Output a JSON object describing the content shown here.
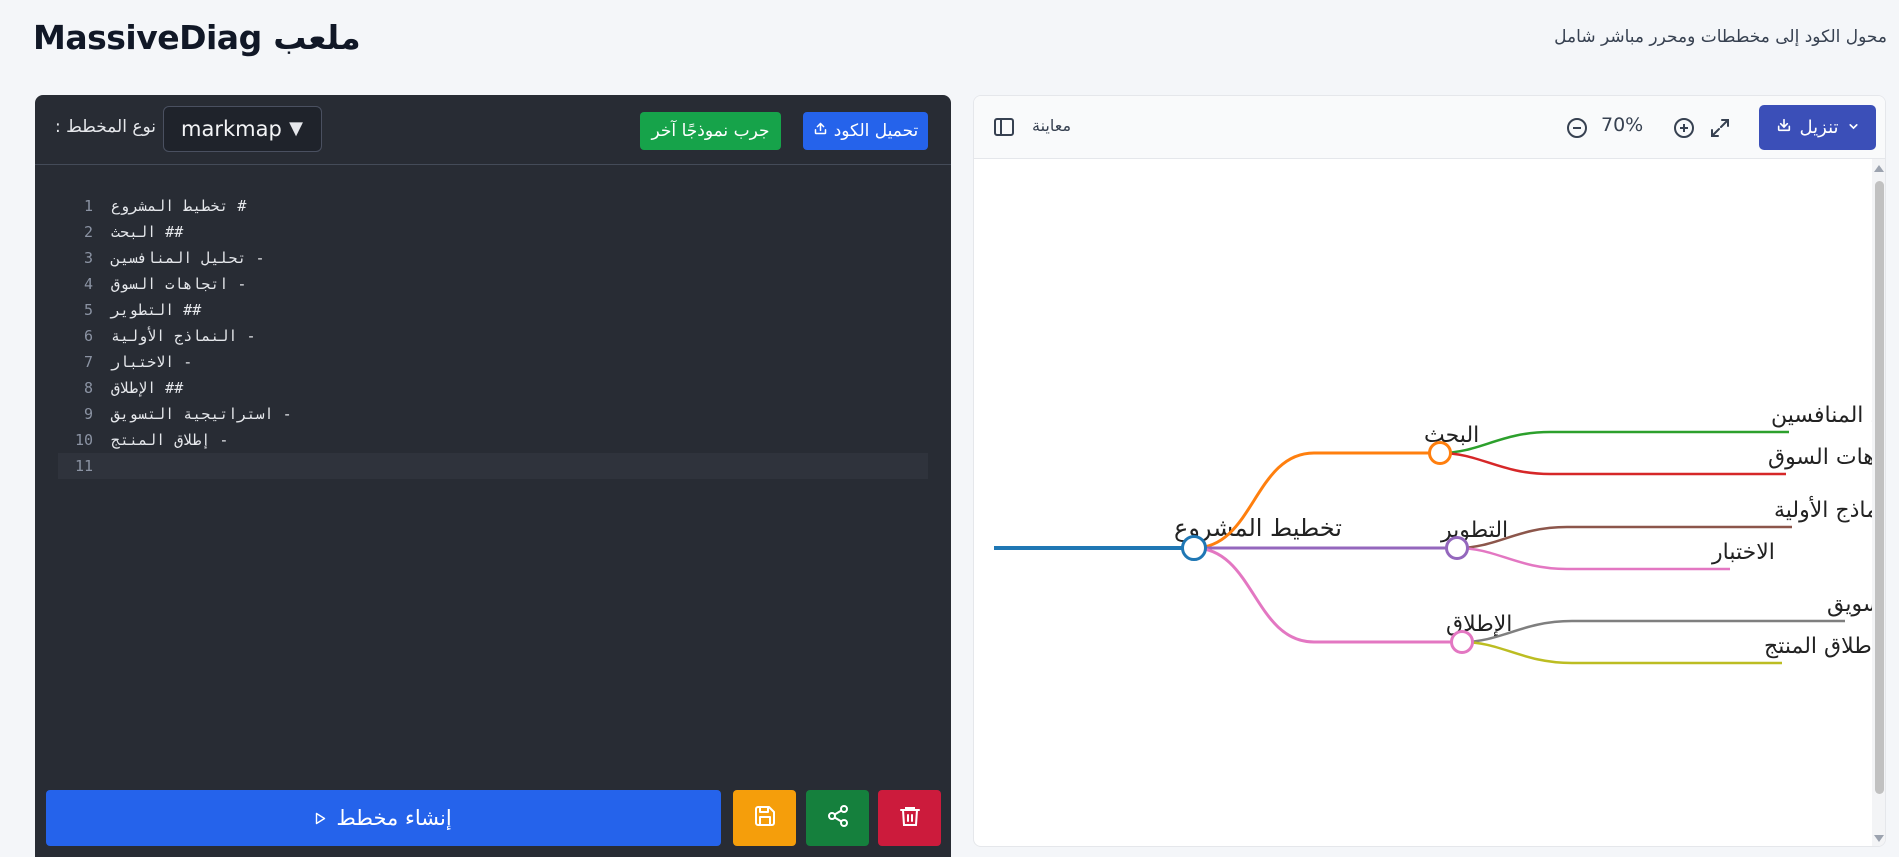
{
  "header": {
    "title": "ملعب MassiveDiag",
    "subtitle": "محول الكود إلى مخططات ومحرر مباشر شامل"
  },
  "editor": {
    "type_label": "نوع المخطط :",
    "diagram_type": "markmap",
    "try_example_label": "جرب نموذجًا آخر",
    "upload_label": "تحميل الكود",
    "lines": [
      {
        "num": "1",
        "text": "# تخطيط المشروع"
      },
      {
        "num": "2",
        "text": "## البحث"
      },
      {
        "num": "3",
        "text": "- تحليل المنافسين"
      },
      {
        "num": "4",
        "text": "- اتجاهات السوق"
      },
      {
        "num": "5",
        "text": "## التطوير"
      },
      {
        "num": "6",
        "text": "- النماذج الأولية"
      },
      {
        "num": "7",
        "text": "- الاختبار"
      },
      {
        "num": "8",
        "text": "## الإطلاق"
      },
      {
        "num": "9",
        "text": "- استراتيجية التسويق"
      },
      {
        "num": "10",
        "text": "- إطلاق المنتج"
      },
      {
        "num": "11",
        "text": ""
      }
    ],
    "generate_label": "إنشاء مخطط",
    "icons": {
      "save": "save-icon",
      "share": "share-icon",
      "delete": "trash-icon"
    }
  },
  "preview": {
    "label": "معاينة",
    "zoom": "70%",
    "download_label": "تنزيل",
    "mindmap": {
      "root": {
        "label": "تخطيط المشروع",
        "color": "#1f77b4"
      },
      "branches": [
        {
          "label": "البحث",
          "color": "#ff7f0e",
          "children": [
            {
              "label": "تحليل المنافسين",
              "color": "#2ca02c"
            },
            {
              "label": "اتجاهات السوق",
              "color": "#d62728"
            }
          ]
        },
        {
          "label": "التطوير",
          "color": "#9467bd",
          "children": [
            {
              "label": "النماذج الأولية",
              "color": "#8c564b"
            },
            {
              "label": "الاختبار",
              "color": "#e377c2"
            }
          ]
        },
        {
          "label": "الإطلاق",
          "color": "#e377c2",
          "children": [
            {
              "label": "استراتيجية التسويق",
              "color": "#7f7f7f"
            },
            {
              "label": "إطلاق المنتج",
              "color": "#bcbd22"
            }
          ]
        }
      ]
    }
  },
  "colors": {
    "editor_bg": "#282c34",
    "primary": "#2563eb",
    "success": "#16a34a",
    "warning": "#f59e0b",
    "danger": "#cc1b3c",
    "download": "#3b4fb8"
  }
}
